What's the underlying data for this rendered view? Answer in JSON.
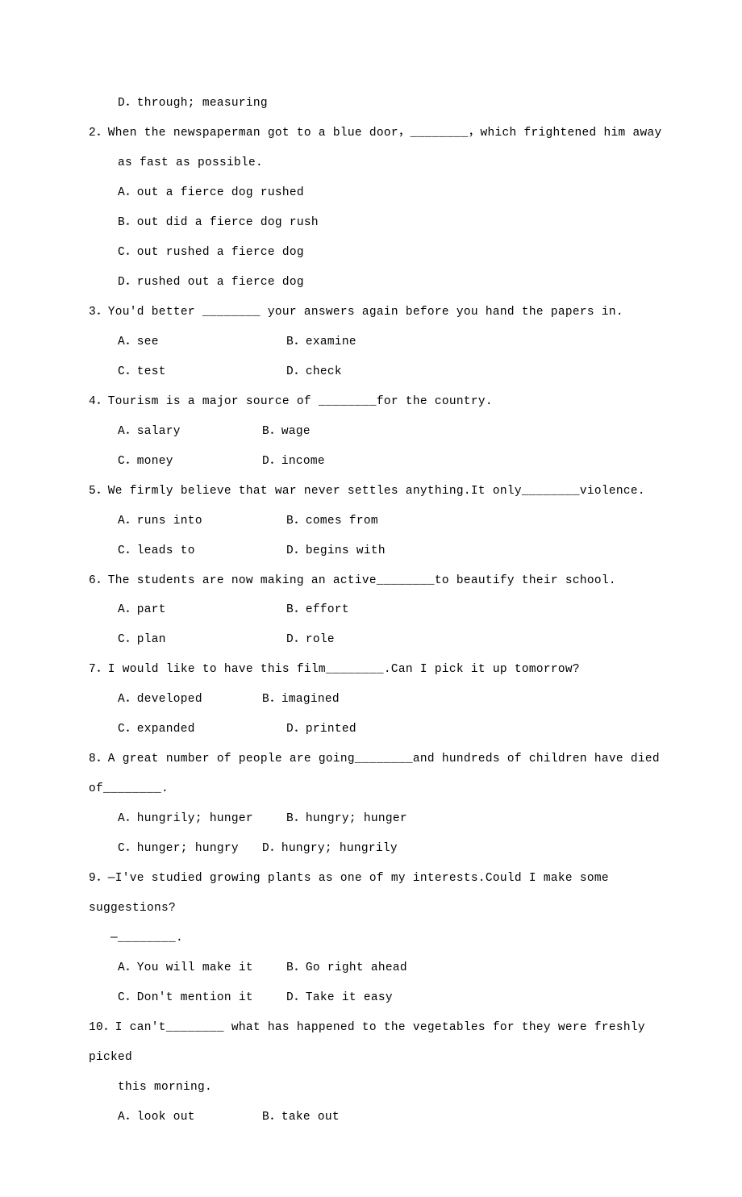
{
  "q1": {
    "optD": "D．through; measuring"
  },
  "q2": {
    "prompt": "2．When the newspaperman got to a blue door，________，which frightened him away",
    "promptCont": "as fast as possible.",
    "optA": "A．out a fierce dog rushed",
    "optB": "B．out did a fierce dog rush",
    "optC": "C．out rushed a fierce dog",
    "optD": "D．rushed out a fierce dog"
  },
  "q3": {
    "prompt": "3．You'd better ________ your answers again before you hand the papers in.",
    "optA": "A．see",
    "optB": "B．examine",
    "optC": "C．test",
    "optD": "D．check"
  },
  "q4": {
    "prompt": "4．Tourism is a major source of ________for the country.",
    "optA": "A．salary",
    "optB": "B．wage",
    "optC": "C．money",
    "optD": "D．income"
  },
  "q5": {
    "prompt": "5．We firmly believe that war never settles anything.It only________violence.",
    "optA": "A．runs into",
    "optB": "B．comes from",
    "optC": "C．leads to",
    "optD": "D．begins with"
  },
  "q6": {
    "prompt": "6．The students are now making an active________to beautify their school.",
    "optA": "A．part",
    "optB": "B．effort",
    "optC": "C．plan",
    "optD": "D．role"
  },
  "q7": {
    "prompt": "7．I would like to have this film________.Can I pick it up tomorrow?",
    "optA": "A．developed",
    "optB": "B．imagined",
    "optC": "C．expanded",
    "optD": "D．printed"
  },
  "q8": {
    "prompt": "8．A great number of people are going________and hundreds of children have died",
    "promptCont": "of________.",
    "optA": "A．hungrily; hunger",
    "optB": "B．hungry; hunger",
    "optC": "C．hunger; hungry",
    "optD": "D．hungry; hungrily"
  },
  "q9": {
    "prompt": "9．—I've studied growing plants as one of my interests.Could I make some",
    "promptCont": "suggestions?",
    "promptReply": "—________.",
    "optA": "A．You will make it",
    "optB": "B．Go right ahead",
    "optC": "C．Don't mention it",
    "optD": "D．Take it easy"
  },
  "q10": {
    "prompt": "10．I can't________ what has happened to the vegetables for they were freshly picked",
    "promptCont": "this morning.",
    "optA": "A．look out",
    "optB": "B．take out"
  }
}
